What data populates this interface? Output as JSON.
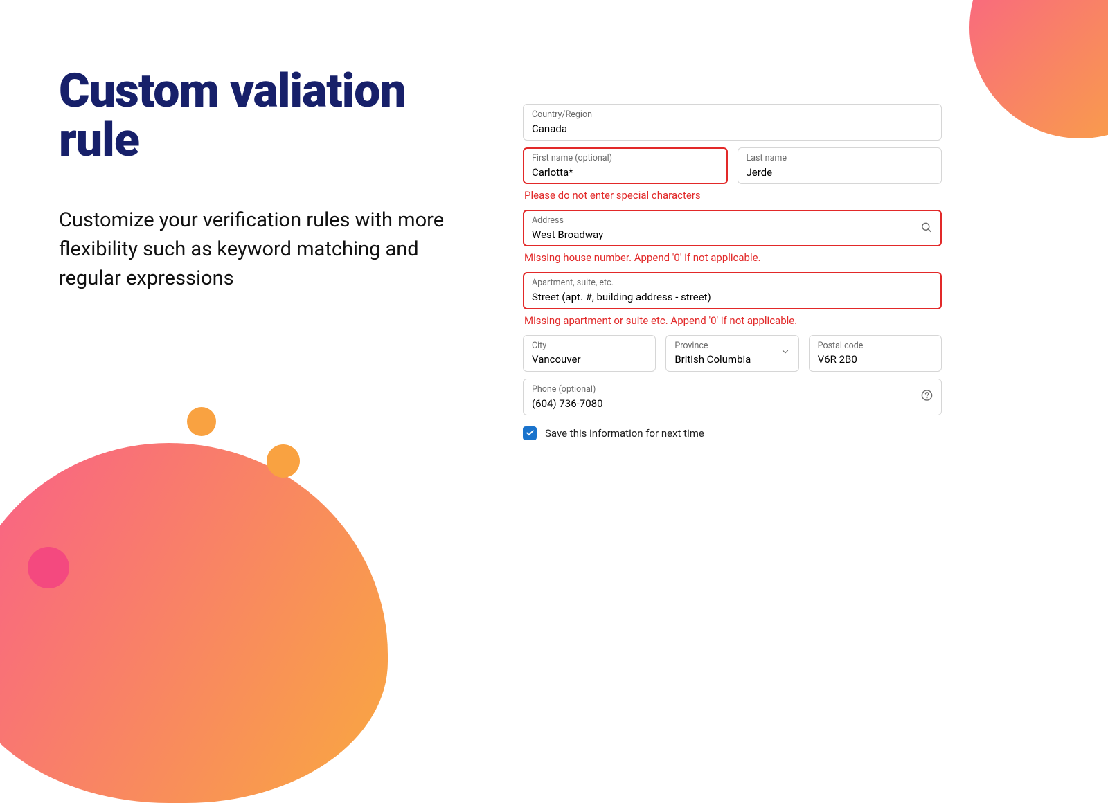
{
  "heading": "Custom valiation rule",
  "subheading": "Customize your verification rules with more flexibility such as keyword matching and regular expressions",
  "form": {
    "country": {
      "label": "Country/Region",
      "value": "Canada"
    },
    "first_name": {
      "label": "First name (optional)",
      "value": "Carlotta*",
      "error": "Please do not enter special characters"
    },
    "last_name": {
      "label": "Last name",
      "value": "Jerde"
    },
    "address": {
      "label": "Address",
      "value": "West Broadway",
      "error": "Missing house number. Append '0' if not applicable."
    },
    "apartment": {
      "label": "Apartment, suite, etc.",
      "value": "Street (apt. #, building address - street)",
      "error": "Missing apartment or suite etc. Append '0' if not applicable."
    },
    "city": {
      "label": "City",
      "value": "Vancouver"
    },
    "province": {
      "label": "Province",
      "value": "British Columbia"
    },
    "postal": {
      "label": "Postal code",
      "value": "V6R 2B0"
    },
    "phone": {
      "label": "Phone (optional)",
      "value": "(604) 736-7080"
    },
    "save_info": {
      "label": "Save this information for next time",
      "checked": true
    }
  }
}
